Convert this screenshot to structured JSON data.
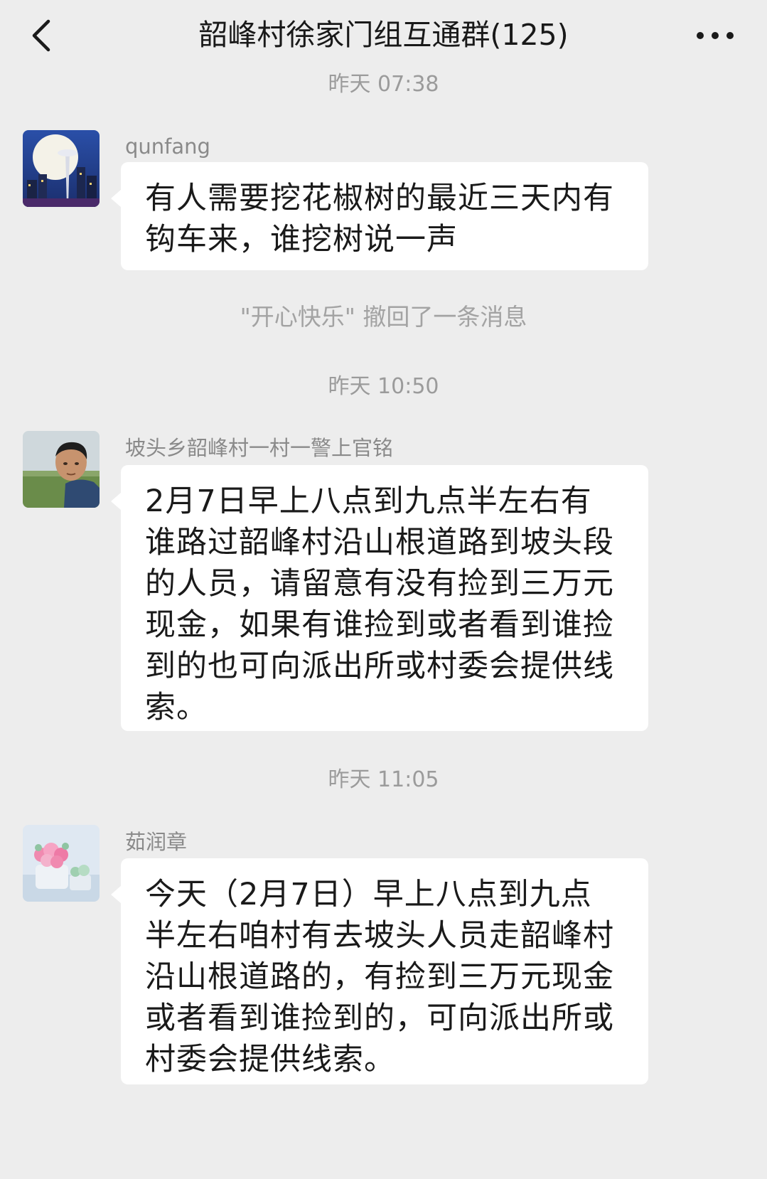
{
  "header": {
    "title": "韶峰村徐家门组互通群(125)",
    "back_icon": "chevron-left-icon",
    "more_icon": "more-dots-icon"
  },
  "messages": [
    {
      "type": "timestamp",
      "text": "昨天 07:38"
    },
    {
      "type": "message",
      "sender": "qunfang",
      "avatar": "night-city-moon-avatar",
      "lines": [
        "有人需要挖花椒树的最近三天内有",
        "钩车来，谁挖树说一声"
      ]
    },
    {
      "type": "system",
      "text": "\"开心快乐\" 撤回了一条消息"
    },
    {
      "type": "timestamp",
      "text": "昨天 10:50"
    },
    {
      "type": "message",
      "sender": "坡头乡韶峰村一村一警上官铭",
      "avatar": "man-portrait-avatar",
      "lines": [
        "2月7日早上八点到九点半左右有",
        "谁路过韶峰村沿山根道路到坡头段",
        "的人员，请留意有没有捡到三万元",
        "现金，如果有谁捡到或者看到谁捡",
        "到的也可向派出所或村委会提供线",
        "索。"
      ]
    },
    {
      "type": "timestamp",
      "text": "昨天 11:05"
    },
    {
      "type": "message",
      "sender": "茹润章",
      "avatar": "flower-bouquet-avatar",
      "lines": [
        "今天（2月7日）早上八点到九点",
        "半左右咱村有去坡头人员走韶峰村",
        "沿山根道路的，有捡到三万元现金",
        "或者看到谁捡到的，可向派出所或",
        "村委会提供线索。"
      ]
    }
  ],
  "colors": {
    "background": "#ededed",
    "bubble": "#ffffff",
    "text": "#1a1a1a",
    "muted": "#9b9b9b"
  }
}
